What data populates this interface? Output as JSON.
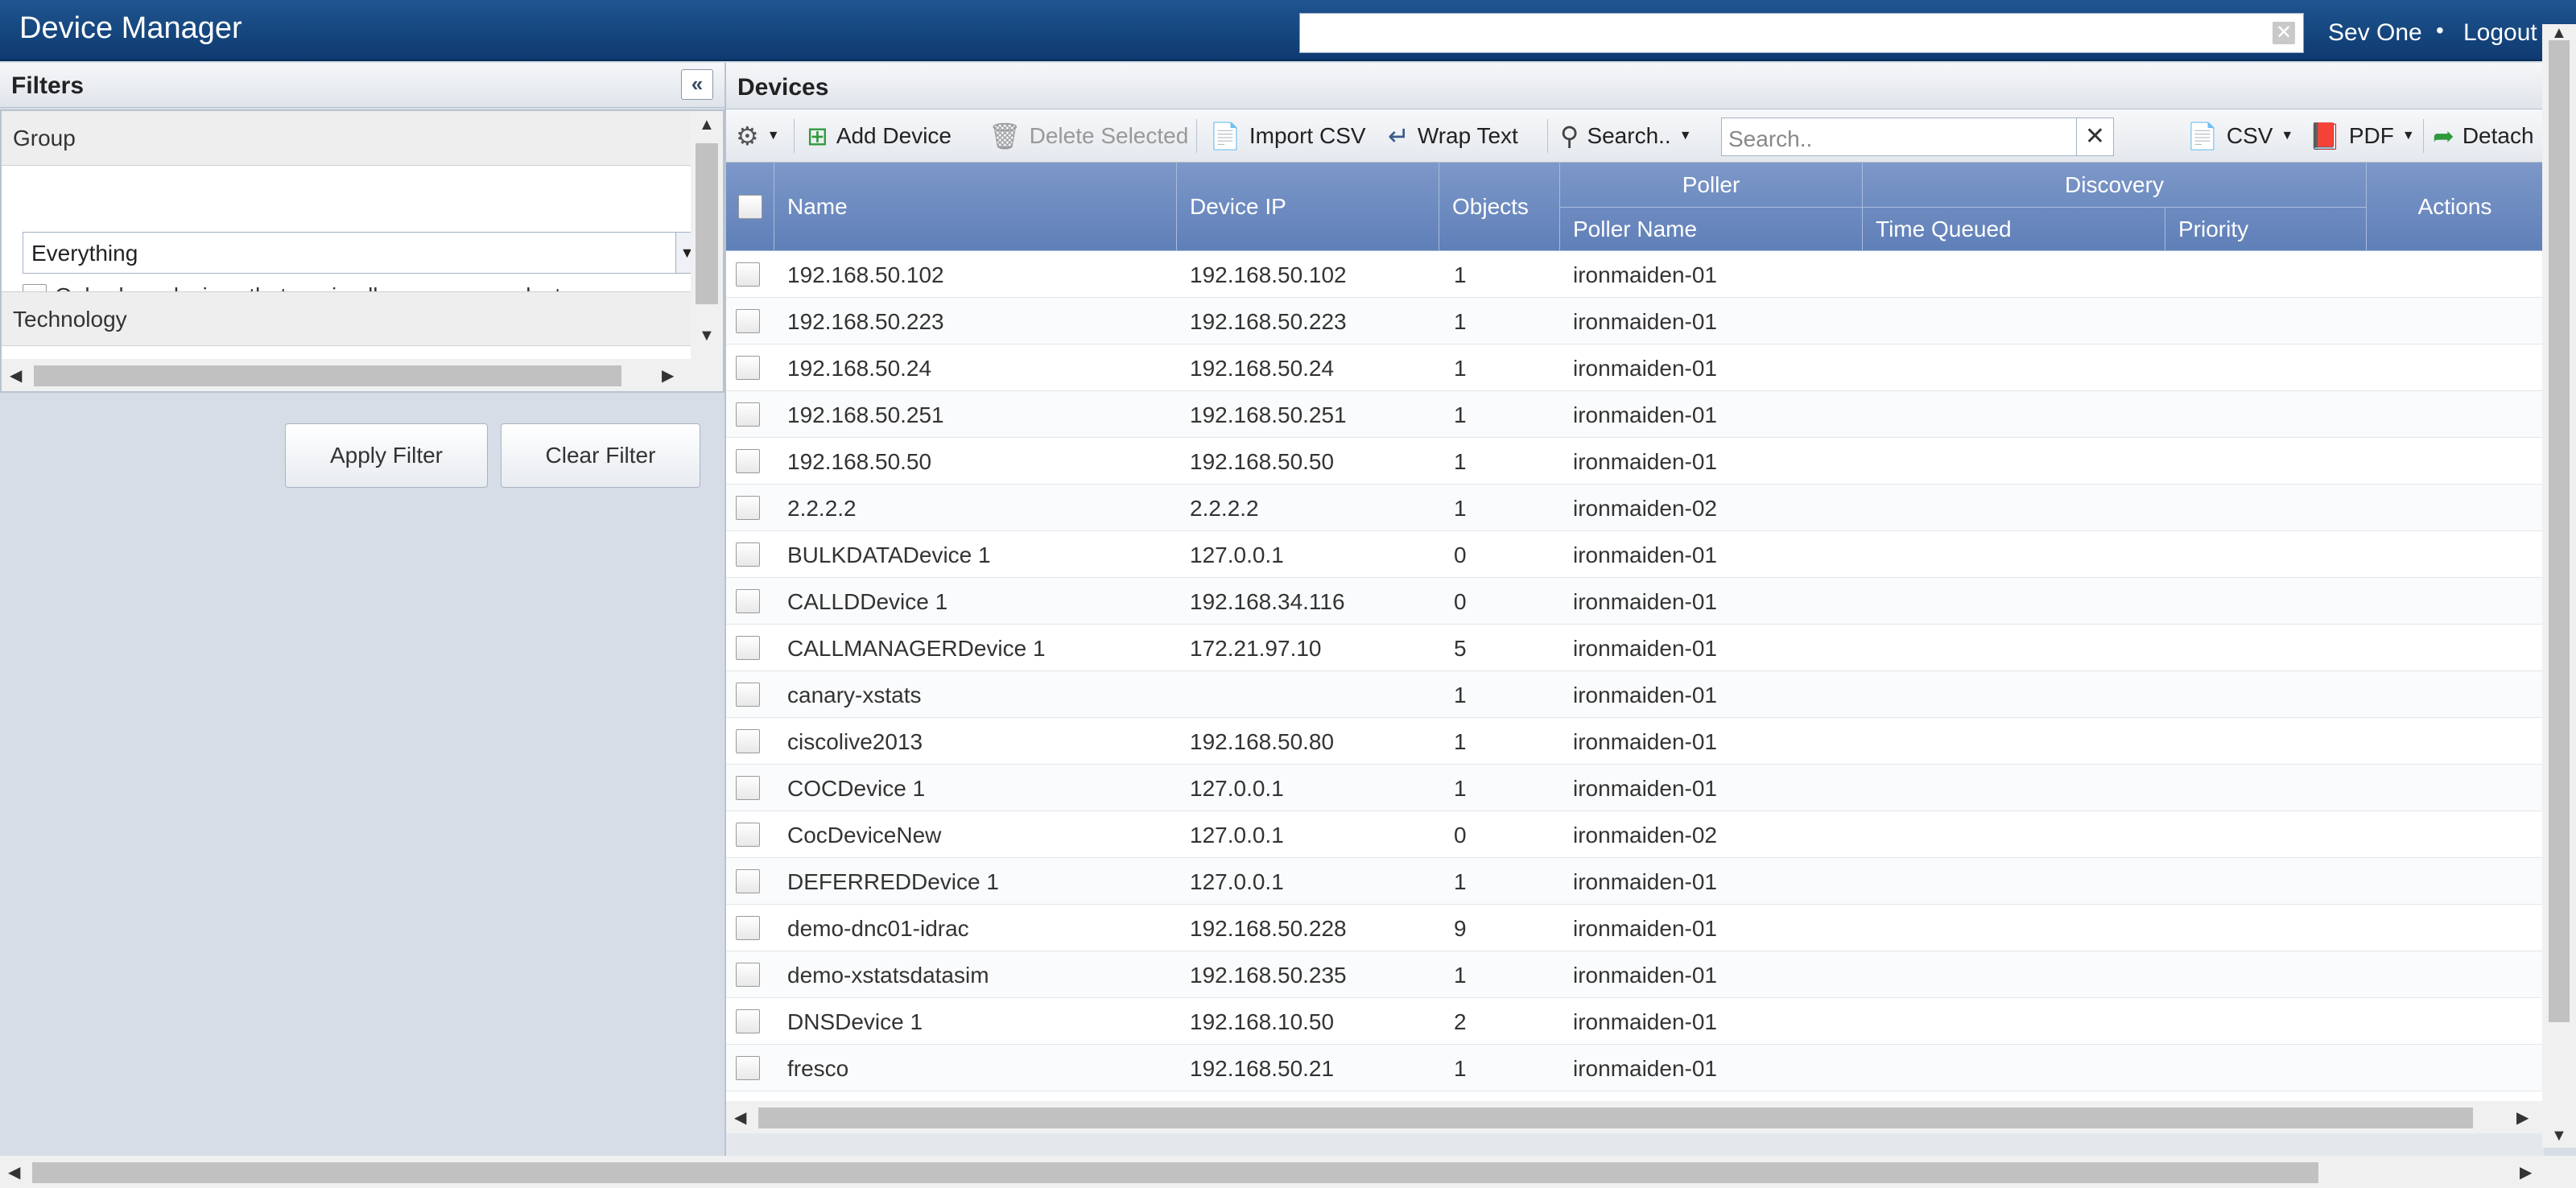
{
  "header": {
    "title": "Device Manager",
    "user": "Sev One",
    "separator": "•",
    "logout": "Logout",
    "search_clear": "✕"
  },
  "filters": {
    "title": "Filters",
    "collapse_glyph": "«",
    "group_label": "Group",
    "group_value": "Everything",
    "only_show_label": "Only show devices that are in all groups you select.",
    "technology_label": "Technology",
    "apply_label": "Apply Filter",
    "clear_label": "Clear Filter"
  },
  "devices": {
    "title": "Devices",
    "toolbar": {
      "add_device": "Add Device",
      "delete_selected": "Delete Selected",
      "import_csv": "Import CSV",
      "wrap_text": "Wrap Text",
      "search_menu": "Search..",
      "search_placeholder": "Search..",
      "search_clear": "✕",
      "csv": "CSV",
      "pdf": "PDF",
      "detach": "Detach"
    },
    "columns": {
      "name": "Name",
      "device_ip": "Device IP",
      "objects": "Objects",
      "poller": "Poller",
      "poller_name": "Poller Name",
      "discovery": "Discovery",
      "time_queued": "Time Queued",
      "priority": "Priority",
      "actions": "Actions"
    },
    "rows": [
      {
        "name": "192.168.50.102",
        "ip": "192.168.50.102",
        "objects": "1",
        "poller": "ironmaiden-01"
      },
      {
        "name": "192.168.50.223",
        "ip": "192.168.50.223",
        "objects": "1",
        "poller": "ironmaiden-01"
      },
      {
        "name": "192.168.50.24",
        "ip": "192.168.50.24",
        "objects": "1",
        "poller": "ironmaiden-01"
      },
      {
        "name": "192.168.50.251",
        "ip": "192.168.50.251",
        "objects": "1",
        "poller": "ironmaiden-01"
      },
      {
        "name": "192.168.50.50",
        "ip": "192.168.50.50",
        "objects": "1",
        "poller": "ironmaiden-01"
      },
      {
        "name": "2.2.2.2",
        "ip": "2.2.2.2",
        "objects": "1",
        "poller": "ironmaiden-02"
      },
      {
        "name": "BULKDATADevice 1",
        "ip": "127.0.0.1",
        "objects": "0",
        "poller": "ironmaiden-01"
      },
      {
        "name": "CALLDDevice 1",
        "ip": "192.168.34.116",
        "objects": "0",
        "poller": "ironmaiden-01"
      },
      {
        "name": "CALLMANAGERDevice 1",
        "ip": "172.21.97.10",
        "objects": "5",
        "poller": "ironmaiden-01"
      },
      {
        "name": "canary-xstats",
        "ip": "",
        "objects": "1",
        "poller": "ironmaiden-01"
      },
      {
        "name": "ciscolive2013",
        "ip": "192.168.50.80",
        "objects": "1",
        "poller": "ironmaiden-01"
      },
      {
        "name": "COCDevice 1",
        "ip": "127.0.0.1",
        "objects": "1",
        "poller": "ironmaiden-01"
      },
      {
        "name": "CocDeviceNew",
        "ip": "127.0.0.1",
        "objects": "0",
        "poller": "ironmaiden-02"
      },
      {
        "name": "DEFERREDDevice 1",
        "ip": "127.0.0.1",
        "objects": "1",
        "poller": "ironmaiden-01"
      },
      {
        "name": "demo-dnc01-idrac",
        "ip": "192.168.50.228",
        "objects": "9",
        "poller": "ironmaiden-01"
      },
      {
        "name": "demo-xstatsdatasim",
        "ip": "192.168.50.235",
        "objects": "1",
        "poller": "ironmaiden-01"
      },
      {
        "name": "DNSDevice 1",
        "ip": "192.168.10.50",
        "objects": "2",
        "poller": "ironmaiden-01"
      },
      {
        "name": "fresco",
        "ip": "192.168.50.21",
        "objects": "1",
        "poller": "ironmaiden-01"
      }
    ]
  },
  "icons": {
    "gear": "gear-icon",
    "add": "add-device-icon",
    "trash": "trash-icon",
    "import": "import-csv-icon",
    "wrap": "wrap-text-icon",
    "search": "search-icon",
    "csv": "csv-icon",
    "pdf": "pdf-icon",
    "detach": "detach-icon"
  },
  "colors": {
    "header_bg": "#0e3a70",
    "grid_header_bg": "#6a88c0"
  }
}
